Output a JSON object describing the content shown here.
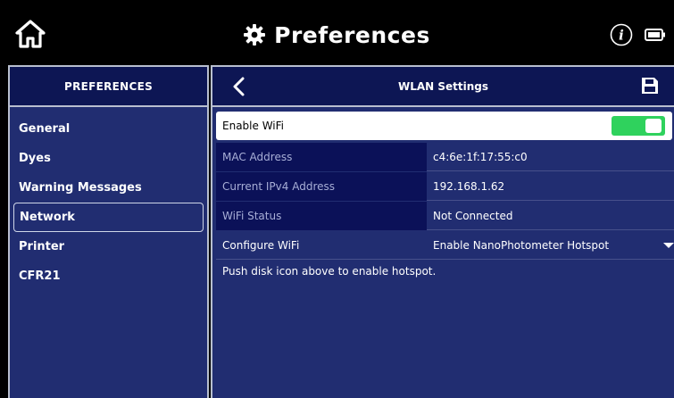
{
  "app": {
    "title": "Preferences"
  },
  "sidebar": {
    "header": "PREFERENCES",
    "items": [
      {
        "label": "General"
      },
      {
        "label": "Dyes"
      },
      {
        "label": "Warning Messages"
      },
      {
        "label": "Network",
        "active": true
      },
      {
        "label": "Printer"
      },
      {
        "label": "CFR21"
      }
    ]
  },
  "panel": {
    "title": "WLAN Settings",
    "enable_wifi": {
      "label": "Enable WiFi",
      "on": true
    },
    "mac": {
      "label": "MAC Address",
      "value": "c4:6e:1f:17:55:c0"
    },
    "ip": {
      "label": "Current IPv4 Address",
      "value": "192.168.1.62"
    },
    "status": {
      "label": "WiFi Status",
      "value": "Not Connected"
    },
    "configure": {
      "label": "Configure WiFi",
      "value": "Enable NanoPhotometer Hotspot"
    },
    "hint": "Push disk icon above to enable hotspot."
  },
  "icons": {
    "home": "home-icon",
    "settings": "gear-icon",
    "info": "info-icon",
    "battery": "battery-icon",
    "back": "back-chevron-icon",
    "save": "save-disk-icon"
  },
  "colors": {
    "panel_bg": "#212d71",
    "header_bg": "#0d1654",
    "toggle_on": "#2fd25d"
  }
}
